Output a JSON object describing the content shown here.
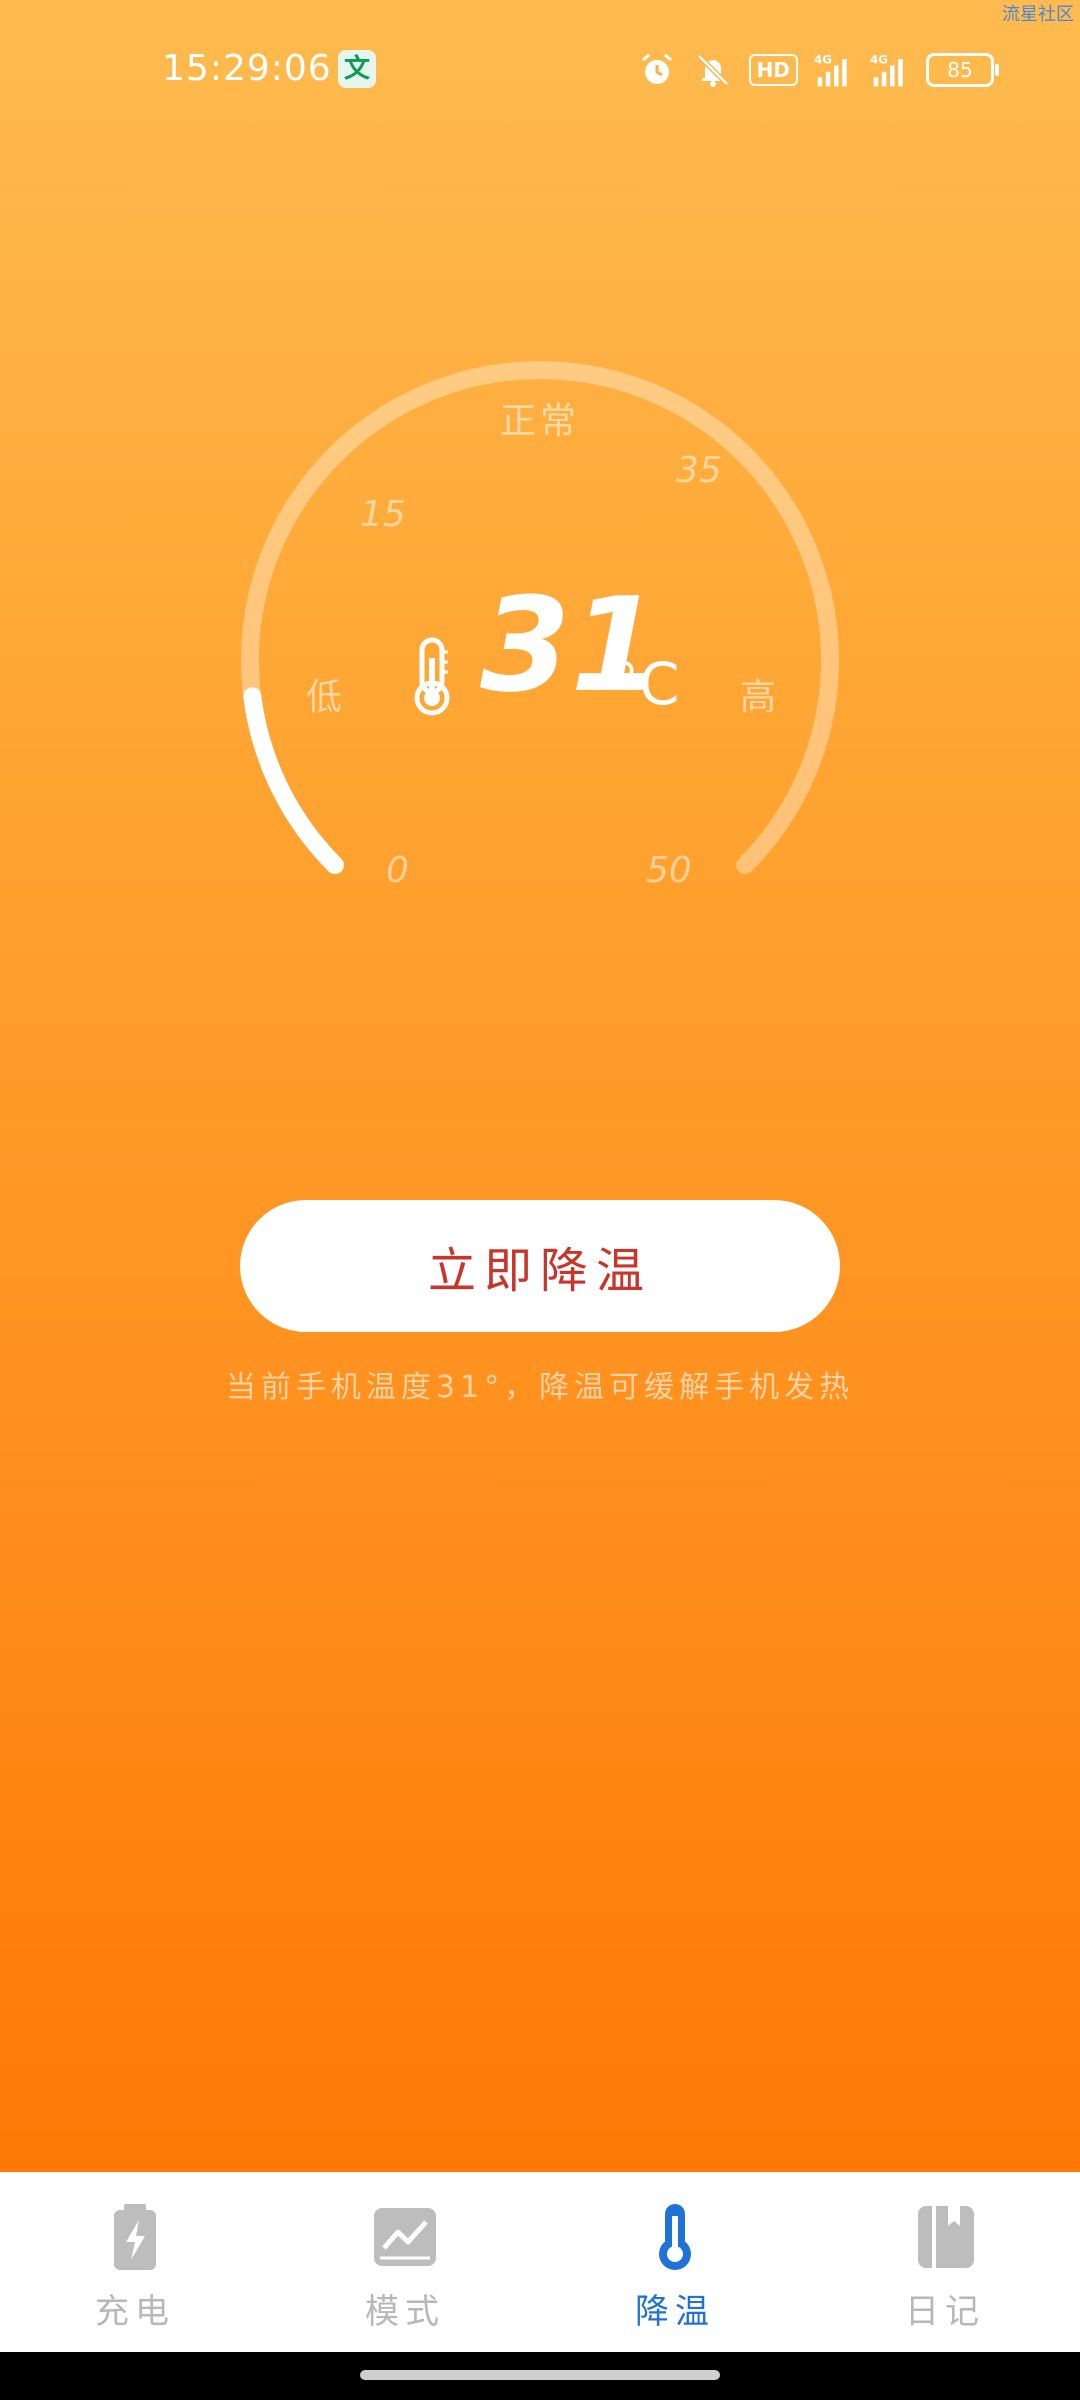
{
  "watermark": "流星社区",
  "status_bar": {
    "time": "15:29:06",
    "app_badge": "文",
    "icons": [
      "alarm-icon",
      "mute-bell-icon",
      "hd-icon",
      "signal-4g-icon",
      "signal-4g-icon-2",
      "battery-icon"
    ],
    "hd_label": "HD",
    "sig1_label": "4G",
    "sig2_label": "4G",
    "battery": "85"
  },
  "gauge": {
    "labels": {
      "normal": "正常",
      "low": "低",
      "high": "高"
    },
    "ticks": [
      "0",
      "15",
      "35",
      "50"
    ],
    "min": 0,
    "max": 50,
    "value": 31,
    "value_text": "31",
    "unit": "°C",
    "track_color": "#FFFFFF",
    "fill_color": "#FFFFFF"
  },
  "action": {
    "button_label": "立即降温",
    "hint": "当前手机温度31°，降温可缓解手机发热"
  },
  "bottom_nav": {
    "items": [
      {
        "label": "充电",
        "icon": "battery-charge-icon",
        "active": false
      },
      {
        "label": "模式",
        "icon": "chart-picture-icon",
        "active": false
      },
      {
        "label": "降温",
        "icon": "thermometer-icon",
        "active": true
      },
      {
        "label": "日记",
        "icon": "notebook-icon",
        "active": false
      }
    ],
    "active_color": "#1F73D6",
    "inactive_color": "#BDBDBD"
  }
}
